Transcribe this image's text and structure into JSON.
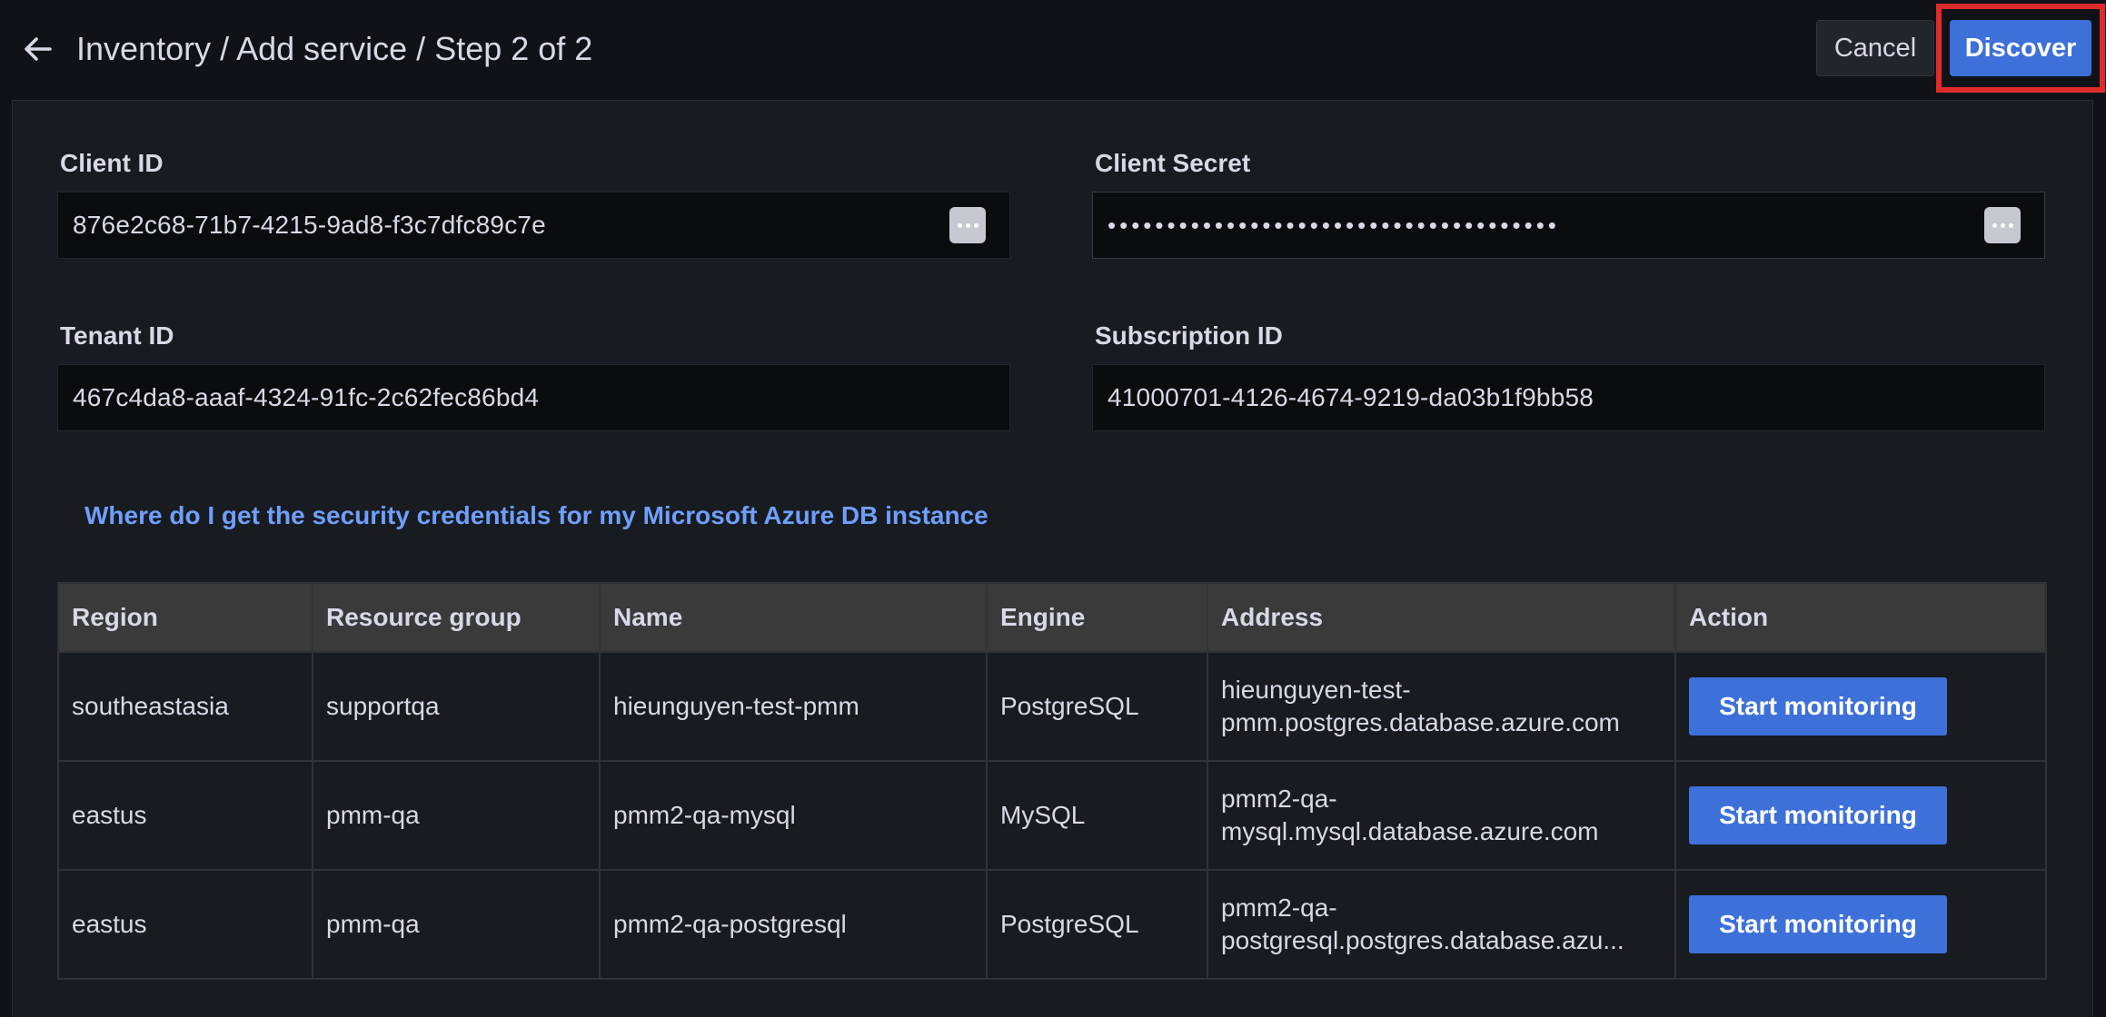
{
  "header": {
    "title": "Inventory / Add service / Step 2 of 2",
    "cancel_label": "Cancel",
    "discover_label": "Discover"
  },
  "form": {
    "client_id": {
      "label": "Client ID",
      "value": "876e2c68-71b7-4215-9ad8-f3c7dfc89c7e"
    },
    "client_secret": {
      "label": "Client Secret",
      "value": "••••••••••••••••••••••••••••••••••••••"
    },
    "tenant_id": {
      "label": "Tenant ID",
      "value": "467c4da8-aaaf-4324-91fc-2c62fec86bd4"
    },
    "subscription_id": {
      "label": "Subscription ID",
      "value": "41000701-4126-4674-9219-da03b1f9bb58"
    }
  },
  "help_link": "Where do I get the security credentials for my Microsoft Azure DB instance",
  "table": {
    "headers": [
      "Region",
      "Resource group",
      "Name",
      "Engine",
      "Address",
      "Action"
    ],
    "rows": [
      {
        "region": "southeastasia",
        "resource_group": "supportqa",
        "name": "hieunguyen-test-pmm",
        "engine": "PostgreSQL",
        "address_line1": "hieunguyen-test-",
        "address_line2": "pmm.postgres.database.azure.com",
        "action": "Start monitoring"
      },
      {
        "region": "eastus",
        "resource_group": "pmm-qa",
        "name": "pmm2-qa-mysql",
        "engine": "MySQL",
        "address_line1": "pmm2-qa-",
        "address_line2": "mysql.mysql.database.azure.com",
        "action": "Start monitoring"
      },
      {
        "region": "eastus",
        "resource_group": "pmm-qa",
        "name": "pmm2-qa-postgresql",
        "engine": "PostgreSQL",
        "address_line1": "pmm2-qa-",
        "address_line2": "postgresql.postgres.database.azu...",
        "action": "Start monitoring"
      }
    ]
  },
  "icons": {
    "back": "arrow-left-icon",
    "password_toggle": "ellipsis-icon"
  },
  "colors": {
    "primary": "#3d71d9",
    "highlight": "#e02b2b",
    "link": "#6e9fff",
    "background": "#111217"
  }
}
